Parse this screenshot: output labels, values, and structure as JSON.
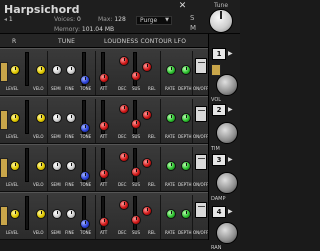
{
  "header": {
    "instrument_name": "Harpsichord",
    "preset_num": "1",
    "voices_label": "Voices:",
    "voices_value": "0",
    "max_label": "Max:",
    "max_value": "128",
    "memory_label": "Memory:",
    "memory_value": "101.04 MB",
    "purge_label": "Purge",
    "tune_label": "Tune",
    "close_glyph": "✕",
    "s_icon": "S",
    "m_icon": "M"
  },
  "sections": {
    "left_label": "R",
    "tune": "TUNE",
    "loudness": "LOUDNESS CONTOUR",
    "lfo": "LFO"
  },
  "row_labels": {
    "level": "LEVEL",
    "velo": "VELO",
    "semi": "SEMI",
    "fine": "FINE",
    "tone": "TONE",
    "att": "ATT",
    "dec": "DEC",
    "sus": "SUS",
    "rel": "REL",
    "rate": "RATE",
    "depth": "DEPTH",
    "onoff": "ON/OFF"
  },
  "right_panel": {
    "btn1": "1",
    "btn2": "2",
    "btn3": "3",
    "btn4": "4",
    "labels": [
      "VOL",
      "TIM",
      "DAMP",
      "RAN"
    ]
  }
}
